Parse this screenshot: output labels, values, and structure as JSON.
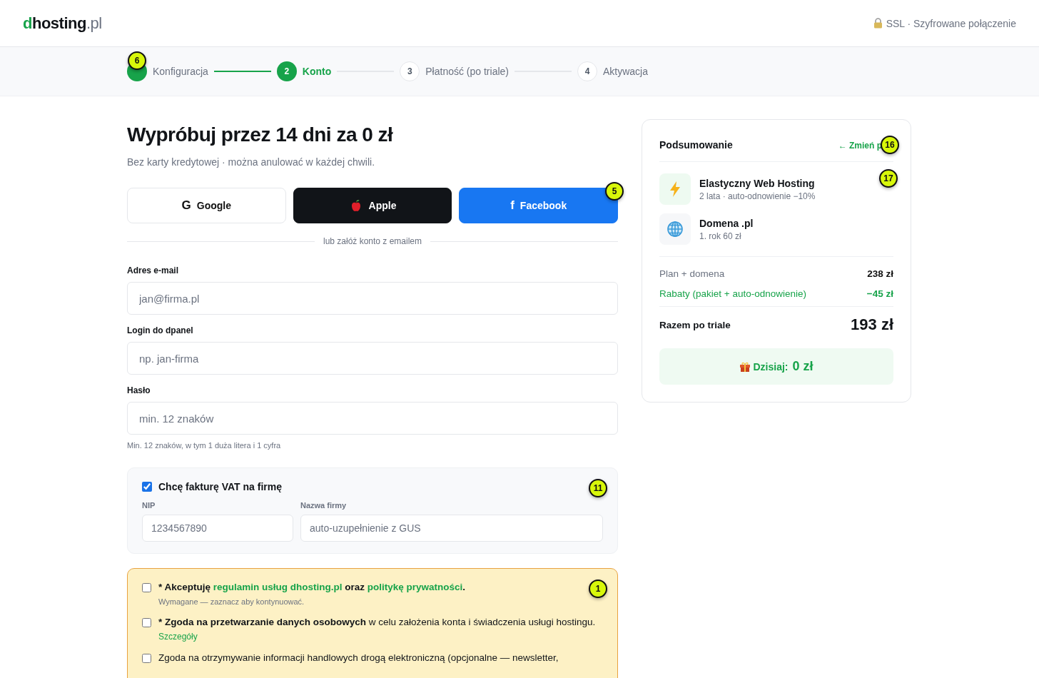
{
  "header": {
    "logo": {
      "accent": "d",
      "main": "hosting",
      "suffix": ".pl"
    },
    "ssl_note": "SSL · Szyfrowane połączenie"
  },
  "steps": [
    {
      "label": "Konfiguracja",
      "done": true,
      "selected": false,
      "marker": "6"
    },
    {
      "number": "2",
      "label": "Konto",
      "done": false,
      "selected": true
    },
    {
      "number": "3",
      "label": "Płatność (po triale)",
      "done": false,
      "selected": false
    },
    {
      "number": "4",
      "label": "Aktywacja",
      "done": false,
      "selected": false
    }
  ],
  "title": "Wypróbuj przez 14 dni za 0 zł",
  "subtitle": "Bez karty kredytowej · można anulować w każdej chwili.",
  "social_buttons": [
    {
      "kind": "google",
      "glyph": "G",
      "label": "Google"
    },
    {
      "kind": "apple",
      "label": "Apple"
    },
    {
      "kind": "facebook",
      "glyph": "f",
      "label": "Facebook",
      "marker": "5"
    }
  ],
  "divider_text": "lub załóż konto z emailem",
  "fields": [
    {
      "label": "Adres e-mail",
      "placeholder": "jan@firma.pl"
    },
    {
      "label": "Login do dpanel",
      "placeholder": "np. jan-firma"
    },
    {
      "label": "Hasło",
      "placeholder": "min. 12 znaków",
      "hint": "Min. 12 znaków, w tym 1 duża litera i 1 cyfra"
    }
  ],
  "vat": {
    "label": "Chcę fakturę VAT na firmę",
    "checked": true,
    "marker": "11",
    "fields": [
      {
        "label": "NIP",
        "placeholder": "1234567890"
      },
      {
        "label": "Nazwa firmy",
        "placeholder": "auto-uzupełnienie z GUS"
      }
    ]
  },
  "consents": {
    "marker": "1",
    "items": [
      {
        "checked": false,
        "parts": [
          {
            "kind": "bold",
            "text": "* Akceptuję "
          },
          {
            "kind": "link",
            "text": "regulamin usług dhosting.pl"
          },
          {
            "kind": "bold",
            "text": " oraz "
          },
          {
            "kind": "link",
            "text": "politykę prywatności"
          },
          {
            "kind": "bold",
            "text": "."
          }
        ],
        "note": "Wymagane — zaznacz aby kontynuować."
      },
      {
        "checked": false,
        "parts": [
          {
            "kind": "bold",
            "text": "* Zgoda na przetwarzanie danych osobowych"
          },
          {
            "kind": "plain",
            "text": " w celu założenia konta i świadczenia usługi hostingu."
          }
        ],
        "link": "Szczegóły"
      },
      {
        "checked": false,
        "parts": [
          {
            "kind": "plain",
            "text": "Zgoda na otrzymywanie informacji handlowych drogą elektroniczną (opcjonalne — newsletter,"
          }
        ]
      }
    ]
  },
  "summary": {
    "title": "Podsumowanie",
    "change_link": "← Zmień p",
    "change_marker": "16",
    "items": [
      {
        "kind": "hosting",
        "name": "Elastyczny Web Hosting",
        "detail": "2 lata · auto-odnowienie −10%",
        "marker": "17"
      },
      {
        "kind": "domain",
        "name": "Domena .pl",
        "detail": "1. rok 60 zł"
      }
    ],
    "lines": [
      {
        "kind": "normal",
        "label": "Plan + domena",
        "value": "238 zł"
      },
      {
        "kind": "discount",
        "label": "Rabaty (pakiet + auto-odnowienie)",
        "value": "−45 zł"
      }
    ],
    "total": {
      "label": "Razem po triale",
      "value": "193 zł"
    },
    "today": {
      "label": "Dzisiaj:",
      "value": "0 zł"
    }
  }
}
